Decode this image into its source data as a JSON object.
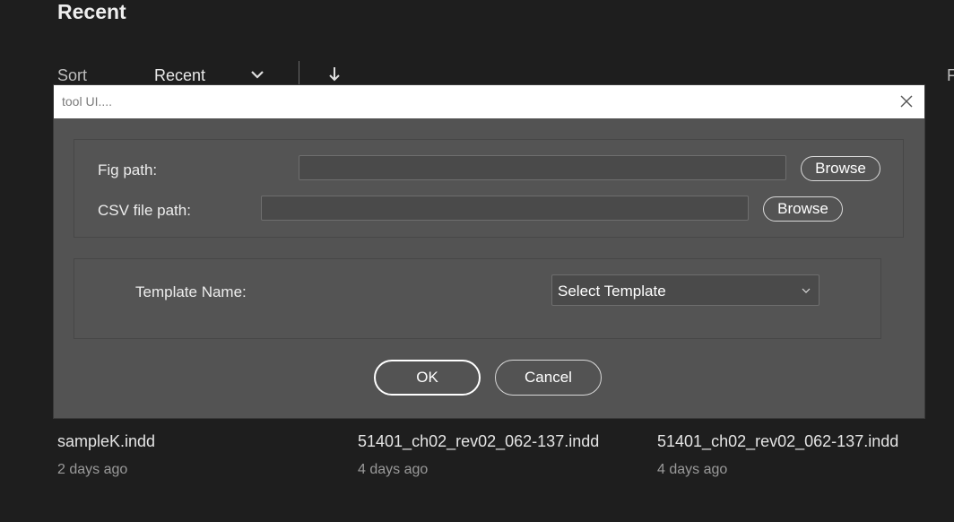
{
  "background": {
    "heading": "Recent",
    "sort": {
      "label": "Sort",
      "value": "Recent",
      "chevron_icon": "chevron-down-icon",
      "direction_icon": "arrow-down-icon"
    },
    "edge_letter": "F",
    "files": [
      {
        "name": "sampleK.indd",
        "time": "2 days ago"
      },
      {
        "name": "51401_ch02_rev02_062-137.indd",
        "time": "4 days ago"
      },
      {
        "name": "51401_ch02_rev02_062-137.indd",
        "time": "4 days ago"
      }
    ]
  },
  "dialog": {
    "title": "tool UI....",
    "close_icon": "close-icon",
    "fig_path": {
      "label": "Fig path:",
      "value": "",
      "browse_label": "Browse"
    },
    "csv_path": {
      "label": "CSV file path:",
      "value": "",
      "browse_label": "Browse"
    },
    "template": {
      "label": "Template Name:",
      "selected": "Select Template"
    },
    "ok_label": "OK",
    "cancel_label": "Cancel"
  },
  "colors": {
    "app_background": "#1e1e1e",
    "dialog_background": "#535353",
    "titlebar_background": "#ffffff"
  }
}
